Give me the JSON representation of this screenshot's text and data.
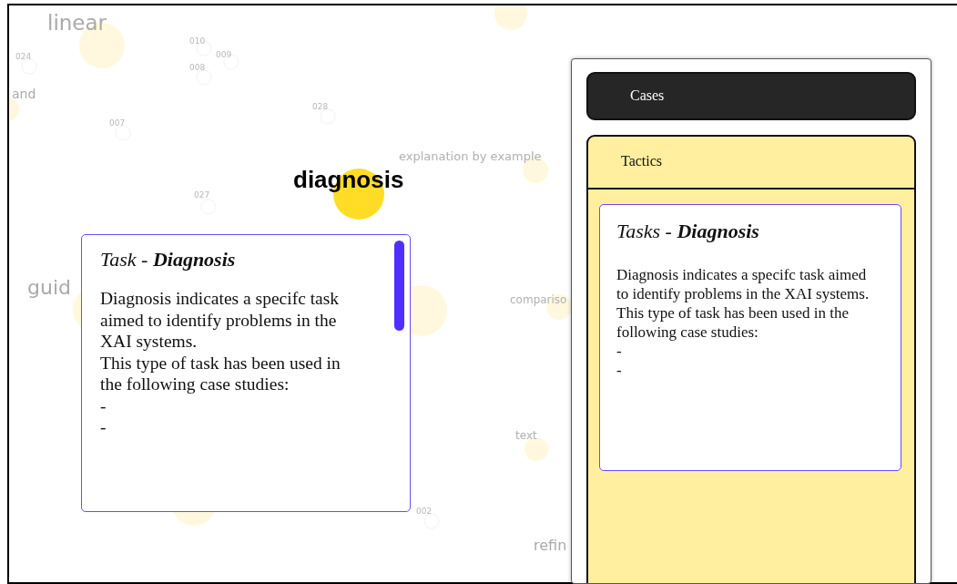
{
  "canvas": {
    "nodes": [
      {
        "label": "linear",
        "kind": "term",
        "selected": false
      },
      {
        "label": "010",
        "kind": "case",
        "selected": false
      },
      {
        "label": "009",
        "kind": "case",
        "selected": false
      },
      {
        "label": "008",
        "kind": "case",
        "selected": false
      },
      {
        "label": "024",
        "kind": "case",
        "selected": false
      },
      {
        "label": "and",
        "kind": "term",
        "selected": false
      },
      {
        "label": "007",
        "kind": "case",
        "selected": false
      },
      {
        "label": "028",
        "kind": "case",
        "selected": false
      },
      {
        "label": "explanation by example",
        "kind": "tag",
        "selected": false
      },
      {
        "label": "diagnosis",
        "kind": "term",
        "selected": true
      },
      {
        "label": "027",
        "kind": "case",
        "selected": false
      },
      {
        "label": "guid",
        "kind": "term",
        "selected": false
      },
      {
        "label": "compariso",
        "kind": "tag",
        "selected": false
      },
      {
        "label": "text",
        "kind": "tag",
        "selected": false
      },
      {
        "label": "002",
        "kind": "case",
        "selected": false
      },
      {
        "label": "refin",
        "kind": "term",
        "selected": false
      }
    ]
  },
  "tooltip": {
    "title": "Task - **Diagnosis**",
    "lines": [
      "Diagnosis indicates a specifc task aimed to identify problems in the XAI systems.",
      "This type of task has been used in the following case studies:",
      "-",
      "-"
    ]
  },
  "panel": {
    "sections": [
      {
        "label": "Cases",
        "expanded": false
      },
      {
        "label": "Tactics",
        "expanded": true,
        "card": {
          "title": "Tasks - **Diagnosis**",
          "lines": [
            "Diagnosis indicates a specifc task aimed to identify problems in the XAI systems.",
            "This type of task has been used in the following case studies:",
            "-",
            "-"
          ]
        }
      }
    ]
  }
}
